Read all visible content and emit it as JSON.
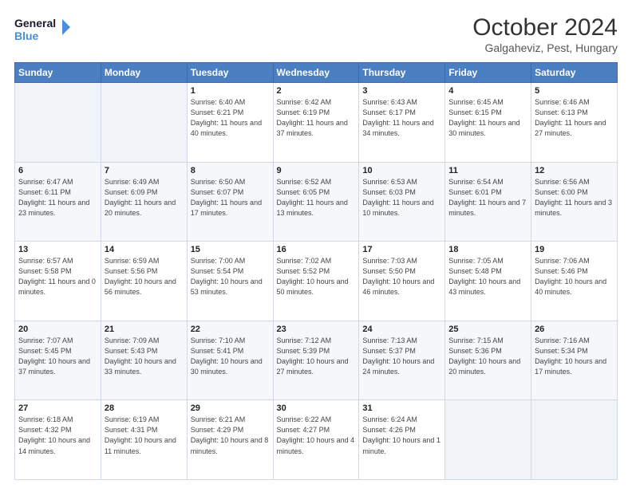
{
  "header": {
    "logo_line1": "General",
    "logo_line2": "Blue",
    "title": "October 2024",
    "subtitle": "Galgaheviz, Pest, Hungary"
  },
  "weekdays": [
    "Sunday",
    "Monday",
    "Tuesday",
    "Wednesday",
    "Thursday",
    "Friday",
    "Saturday"
  ],
  "weeks": [
    [
      {
        "day": "",
        "sunrise": "",
        "sunset": "",
        "daylight": ""
      },
      {
        "day": "",
        "sunrise": "",
        "sunset": "",
        "daylight": ""
      },
      {
        "day": "1",
        "sunrise": "Sunrise: 6:40 AM",
        "sunset": "Sunset: 6:21 PM",
        "daylight": "Daylight: 11 hours and 40 minutes."
      },
      {
        "day": "2",
        "sunrise": "Sunrise: 6:42 AM",
        "sunset": "Sunset: 6:19 PM",
        "daylight": "Daylight: 11 hours and 37 minutes."
      },
      {
        "day": "3",
        "sunrise": "Sunrise: 6:43 AM",
        "sunset": "Sunset: 6:17 PM",
        "daylight": "Daylight: 11 hours and 34 minutes."
      },
      {
        "day": "4",
        "sunrise": "Sunrise: 6:45 AM",
        "sunset": "Sunset: 6:15 PM",
        "daylight": "Daylight: 11 hours and 30 minutes."
      },
      {
        "day": "5",
        "sunrise": "Sunrise: 6:46 AM",
        "sunset": "Sunset: 6:13 PM",
        "daylight": "Daylight: 11 hours and 27 minutes."
      }
    ],
    [
      {
        "day": "6",
        "sunrise": "Sunrise: 6:47 AM",
        "sunset": "Sunset: 6:11 PM",
        "daylight": "Daylight: 11 hours and 23 minutes."
      },
      {
        "day": "7",
        "sunrise": "Sunrise: 6:49 AM",
        "sunset": "Sunset: 6:09 PM",
        "daylight": "Daylight: 11 hours and 20 minutes."
      },
      {
        "day": "8",
        "sunrise": "Sunrise: 6:50 AM",
        "sunset": "Sunset: 6:07 PM",
        "daylight": "Daylight: 11 hours and 17 minutes."
      },
      {
        "day": "9",
        "sunrise": "Sunrise: 6:52 AM",
        "sunset": "Sunset: 6:05 PM",
        "daylight": "Daylight: 11 hours and 13 minutes."
      },
      {
        "day": "10",
        "sunrise": "Sunrise: 6:53 AM",
        "sunset": "Sunset: 6:03 PM",
        "daylight": "Daylight: 11 hours and 10 minutes."
      },
      {
        "day": "11",
        "sunrise": "Sunrise: 6:54 AM",
        "sunset": "Sunset: 6:01 PM",
        "daylight": "Daylight: 11 hours and 7 minutes."
      },
      {
        "day": "12",
        "sunrise": "Sunrise: 6:56 AM",
        "sunset": "Sunset: 6:00 PM",
        "daylight": "Daylight: 11 hours and 3 minutes."
      }
    ],
    [
      {
        "day": "13",
        "sunrise": "Sunrise: 6:57 AM",
        "sunset": "Sunset: 5:58 PM",
        "daylight": "Daylight: 11 hours and 0 minutes."
      },
      {
        "day": "14",
        "sunrise": "Sunrise: 6:59 AM",
        "sunset": "Sunset: 5:56 PM",
        "daylight": "Daylight: 10 hours and 56 minutes."
      },
      {
        "day": "15",
        "sunrise": "Sunrise: 7:00 AM",
        "sunset": "Sunset: 5:54 PM",
        "daylight": "Daylight: 10 hours and 53 minutes."
      },
      {
        "day": "16",
        "sunrise": "Sunrise: 7:02 AM",
        "sunset": "Sunset: 5:52 PM",
        "daylight": "Daylight: 10 hours and 50 minutes."
      },
      {
        "day": "17",
        "sunrise": "Sunrise: 7:03 AM",
        "sunset": "Sunset: 5:50 PM",
        "daylight": "Daylight: 10 hours and 46 minutes."
      },
      {
        "day": "18",
        "sunrise": "Sunrise: 7:05 AM",
        "sunset": "Sunset: 5:48 PM",
        "daylight": "Daylight: 10 hours and 43 minutes."
      },
      {
        "day": "19",
        "sunrise": "Sunrise: 7:06 AM",
        "sunset": "Sunset: 5:46 PM",
        "daylight": "Daylight: 10 hours and 40 minutes."
      }
    ],
    [
      {
        "day": "20",
        "sunrise": "Sunrise: 7:07 AM",
        "sunset": "Sunset: 5:45 PM",
        "daylight": "Daylight: 10 hours and 37 minutes."
      },
      {
        "day": "21",
        "sunrise": "Sunrise: 7:09 AM",
        "sunset": "Sunset: 5:43 PM",
        "daylight": "Daylight: 10 hours and 33 minutes."
      },
      {
        "day": "22",
        "sunrise": "Sunrise: 7:10 AM",
        "sunset": "Sunset: 5:41 PM",
        "daylight": "Daylight: 10 hours and 30 minutes."
      },
      {
        "day": "23",
        "sunrise": "Sunrise: 7:12 AM",
        "sunset": "Sunset: 5:39 PM",
        "daylight": "Daylight: 10 hours and 27 minutes."
      },
      {
        "day": "24",
        "sunrise": "Sunrise: 7:13 AM",
        "sunset": "Sunset: 5:37 PM",
        "daylight": "Daylight: 10 hours and 24 minutes."
      },
      {
        "day": "25",
        "sunrise": "Sunrise: 7:15 AM",
        "sunset": "Sunset: 5:36 PM",
        "daylight": "Daylight: 10 hours and 20 minutes."
      },
      {
        "day": "26",
        "sunrise": "Sunrise: 7:16 AM",
        "sunset": "Sunset: 5:34 PM",
        "daylight": "Daylight: 10 hours and 17 minutes."
      }
    ],
    [
      {
        "day": "27",
        "sunrise": "Sunrise: 6:18 AM",
        "sunset": "Sunset: 4:32 PM",
        "daylight": "Daylight: 10 hours and 14 minutes."
      },
      {
        "day": "28",
        "sunrise": "Sunrise: 6:19 AM",
        "sunset": "Sunset: 4:31 PM",
        "daylight": "Daylight: 10 hours and 11 minutes."
      },
      {
        "day": "29",
        "sunrise": "Sunrise: 6:21 AM",
        "sunset": "Sunset: 4:29 PM",
        "daylight": "Daylight: 10 hours and 8 minutes."
      },
      {
        "day": "30",
        "sunrise": "Sunrise: 6:22 AM",
        "sunset": "Sunset: 4:27 PM",
        "daylight": "Daylight: 10 hours and 4 minutes."
      },
      {
        "day": "31",
        "sunrise": "Sunrise: 6:24 AM",
        "sunset": "Sunset: 4:26 PM",
        "daylight": "Daylight: 10 hours and 1 minute."
      },
      {
        "day": "",
        "sunrise": "",
        "sunset": "",
        "daylight": ""
      },
      {
        "day": "",
        "sunrise": "",
        "sunset": "",
        "daylight": ""
      }
    ]
  ]
}
